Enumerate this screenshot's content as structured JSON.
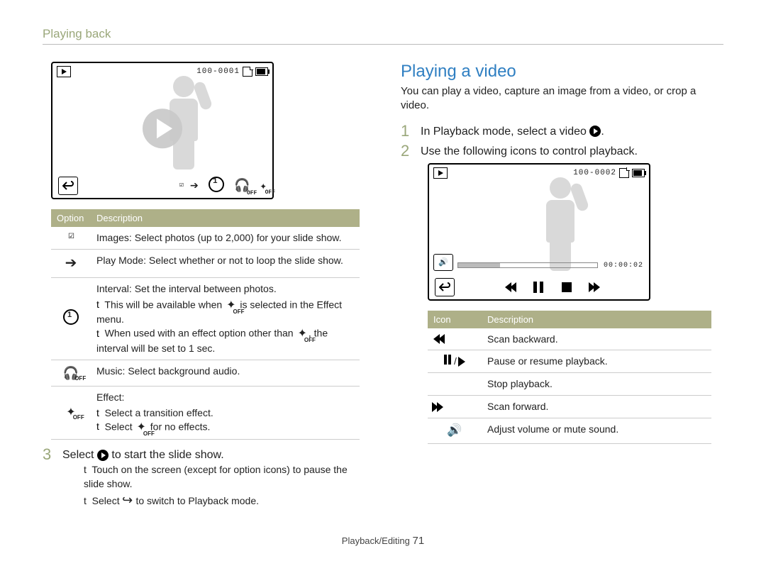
{
  "breadcrumb": "Playing back",
  "left": {
    "screen": {
      "file_no": "100-0001"
    },
    "table": {
      "headers": {
        "col1": "Option",
        "col2": "Description"
      },
      "rows": {
        "images": "Images: Select photos (up to 2,000) for your slide show.",
        "playmode": "Play Mode: Select whether or not to loop the slide show.",
        "interval": {
          "title": "Interval: Set the interval between photos.",
          "b1_a": "This will be available when ",
          "b1_b": " is selected in the Effect menu.",
          "b2_a": "When used with an effect option other than ",
          "b2_b": ", the interval will be set to 1 sec."
        },
        "music": "Music: Select background audio.",
        "effect": {
          "title": "Effect:",
          "b1": "Select a transition effect.",
          "b2_a": "Select ",
          "b2_b": " for no effects."
        }
      }
    },
    "step3": {
      "a": "Select ",
      "b": " to start the slide show.",
      "n1": "Touch on the screen (except for option icons) to pause the slide show.",
      "n2_a": "Select ",
      "n2_b": " to switch to Playback mode."
    }
  },
  "right": {
    "heading": "Playing a video",
    "lead": "You can play a video, capture an image from a video, or crop a video.",
    "step1_a": "In Playback mode, select a video ",
    "step1_b": ".",
    "step2": "Use the following icons to control playback.",
    "screen": {
      "file_no": "100-0002",
      "time": "00:00:02"
    },
    "table": {
      "headers": {
        "col1": "Icon",
        "col2": "Description"
      },
      "rows": {
        "rew": "Scan backward.",
        "pause": "Pause or resume playback.",
        "stop": "Stop playback.",
        "fwd": "Scan forward.",
        "vol": "Adjust volume or mute sound."
      }
    }
  },
  "footer": {
    "section": "Playback/Editing",
    "page": "71"
  }
}
